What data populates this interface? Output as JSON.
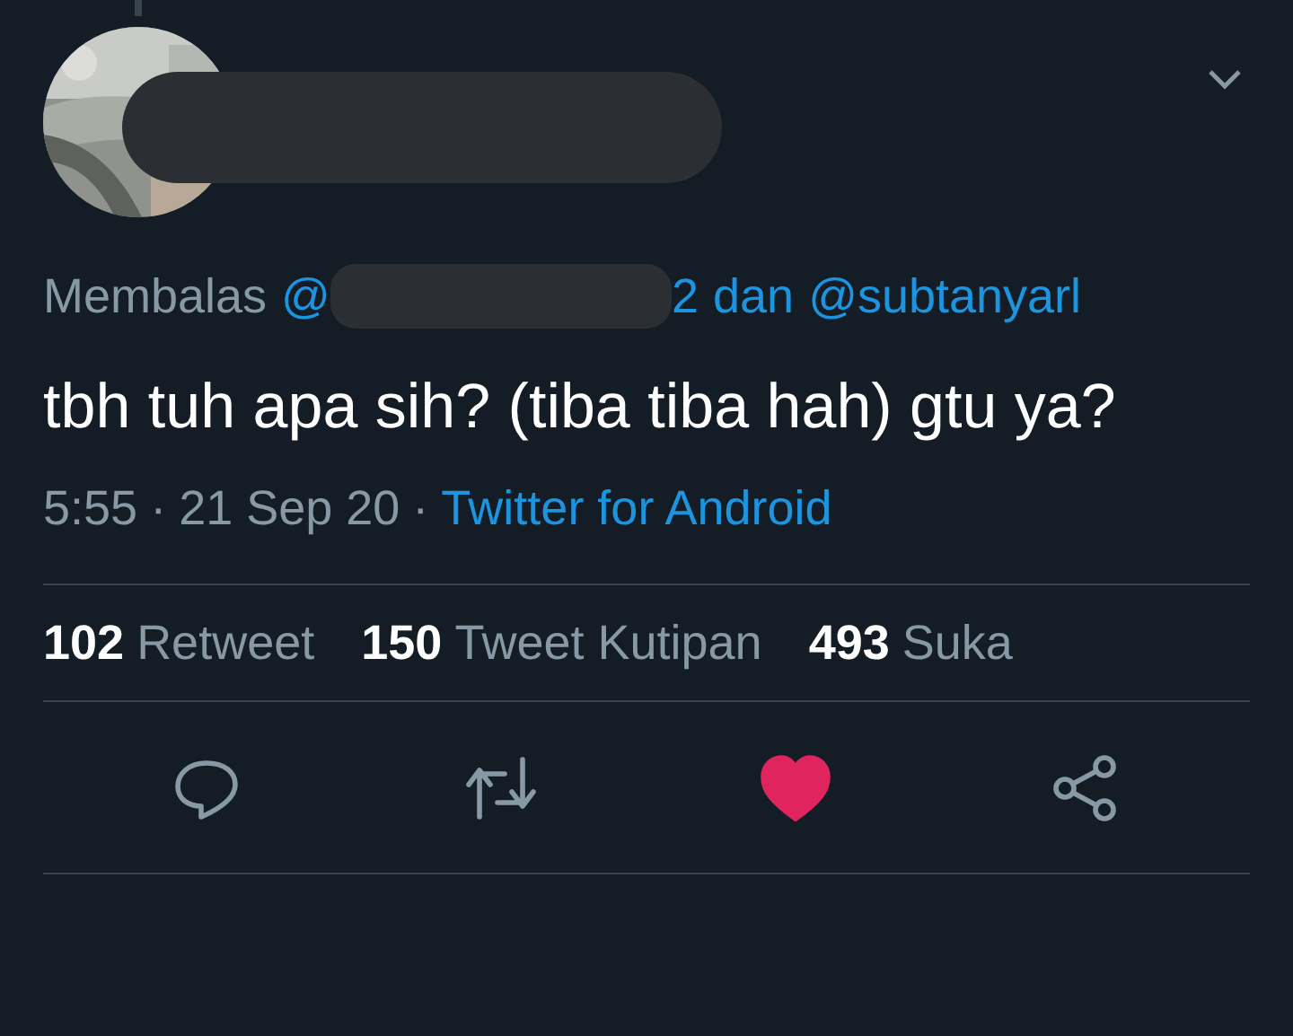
{
  "reply_line": {
    "prefix": "Membalas",
    "mention_1_start": "@",
    "mention_1_end": "2",
    "conjunction": "dan",
    "mention_2": "@subtanyarl"
  },
  "tweet_text": "tbh tuh apa sih? (tiba tiba hah) gtu ya?",
  "meta": {
    "time": "5:55",
    "separator_1": "·",
    "date": "21 Sep 20",
    "separator_2": "·",
    "source": "Twitter for Android"
  },
  "stats": [
    {
      "count": "102",
      "label": "Retweet"
    },
    {
      "count": "150",
      "label": "Tweet Kutipan"
    },
    {
      "count": "493",
      "label": "Suka"
    }
  ],
  "actions": [
    {
      "kind": "reply",
      "selected": false
    },
    {
      "kind": "retweet",
      "selected": false
    },
    {
      "kind": "like",
      "selected": true
    },
    {
      "kind": "share",
      "selected": false
    }
  ]
}
